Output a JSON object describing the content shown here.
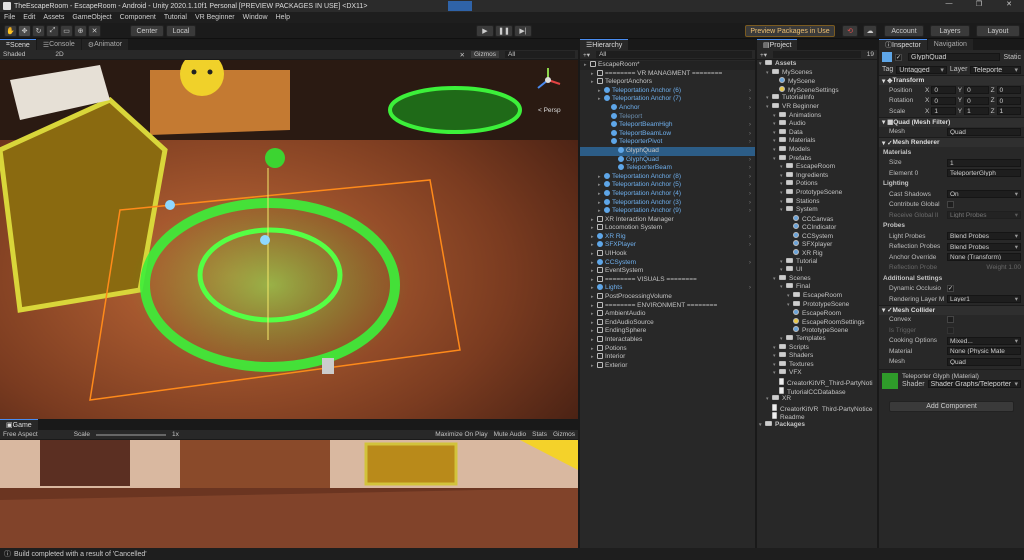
{
  "window": {
    "title": "TheEscapeRoom - EscapeRoom - Android - Unity 2020.1.10f1 Personal [PREVIEW PACKAGES IN USE] <DX11>",
    "controls": [
      "—",
      "❐",
      "✕"
    ]
  },
  "menu": [
    "File",
    "Edit",
    "Assets",
    "GameObject",
    "Component",
    "Tutorial",
    "VR Beginner",
    "Window",
    "Help"
  ],
  "toolbar": {
    "pivot": "Center",
    "space": "Local",
    "preview_packages": "Preview Packages in Use",
    "account": "Account",
    "layers": "Layers",
    "layout": "Layout"
  },
  "scene": {
    "tabs": [
      "Scene",
      "Console",
      "Animator"
    ],
    "shading": "Shaded",
    "mode2d": "2D",
    "gizmos": "Gizmos",
    "search": "All",
    "persp": "< Persp"
  },
  "game": {
    "tab": "Game",
    "aspect": "Free Aspect",
    "scale_label": "Scale",
    "scale_value": "1x",
    "maximize": "Maximize On Play",
    "mute": "Mute Audio",
    "stats": "Stats",
    "gizmos": "Gizmos"
  },
  "hierarchy": {
    "tab": "Hierarchy",
    "search": "All",
    "items": [
      {
        "t": "EscapeRoom*",
        "d": 0,
        "k": "scene"
      },
      {
        "t": "======== VR MANAGMENT ========",
        "d": 1
      },
      {
        "t": "TeleportAnchors",
        "d": 1
      },
      {
        "t": "Teleportation Anchor (6)",
        "d": 2,
        "k": "p"
      },
      {
        "t": "Teleportation Anchor (7)",
        "d": 2,
        "k": "p"
      },
      {
        "t": "Anchor",
        "d": 3,
        "k": "p"
      },
      {
        "t": "Teleport",
        "d": 3,
        "k": "d"
      },
      {
        "t": "TeleportBeamHigh",
        "d": 3,
        "k": "p"
      },
      {
        "t": "TeleportBeamLow",
        "d": 3,
        "k": "p"
      },
      {
        "t": "TeleporterPivot",
        "d": 3,
        "k": "p"
      },
      {
        "t": "GlyphQuad",
        "d": 4,
        "k": "sel"
      },
      {
        "t": "GlyphQuad",
        "d": 4,
        "k": "p"
      },
      {
        "t": "TeleporterBeam",
        "d": 4,
        "k": "p"
      },
      {
        "t": "Teleportation Anchor (8)",
        "d": 2,
        "k": "p"
      },
      {
        "t": "Teleportation Anchor (5)",
        "d": 2,
        "k": "p"
      },
      {
        "t": "Teleportation Anchor (4)",
        "d": 2,
        "k": "p"
      },
      {
        "t": "Teleportation Anchor (3)",
        "d": 2,
        "k": "p"
      },
      {
        "t": "Teleportation Anchor (9)",
        "d": 2,
        "k": "p"
      },
      {
        "t": "XR Interaction Manager",
        "d": 1
      },
      {
        "t": "Locomotion System",
        "d": 1
      },
      {
        "t": "XR Rig",
        "d": 1,
        "k": "p"
      },
      {
        "t": "SFXPlayer",
        "d": 1,
        "k": "p"
      },
      {
        "t": "UIHook",
        "d": 1
      },
      {
        "t": "CCSystem",
        "d": 1,
        "k": "p"
      },
      {
        "t": "EventSystem",
        "d": 1
      },
      {
        "t": "======== VISUALS ========",
        "d": 1
      },
      {
        "t": "Lights",
        "d": 1,
        "k": "p"
      },
      {
        "t": "PostProcessingVolume",
        "d": 1
      },
      {
        "t": "======== ENVIRONMENT ========",
        "d": 1
      },
      {
        "t": "AmbientAudio",
        "d": 1
      },
      {
        "t": "EndAudioSource",
        "d": 1
      },
      {
        "t": "EndingSphere",
        "d": 1
      },
      {
        "t": "Interactables",
        "d": 1
      },
      {
        "t": "Potions",
        "d": 1
      },
      {
        "t": "Interior",
        "d": 1
      },
      {
        "t": "Exterior",
        "d": 1
      }
    ]
  },
  "project": {
    "tab": "Project",
    "count": "19",
    "items": [
      {
        "t": "Assets",
        "d": 0,
        "k": "b"
      },
      {
        "t": "MyScenes",
        "d": 1
      },
      {
        "t": "MyScene",
        "d": 2,
        "k": "s"
      },
      {
        "t": "MySceneSettings",
        "d": 2,
        "k": "y"
      },
      {
        "t": "TutorialInfo",
        "d": 1
      },
      {
        "t": "VR Beginner",
        "d": 1
      },
      {
        "t": "Animations",
        "d": 2
      },
      {
        "t": "Audio",
        "d": 2
      },
      {
        "t": "Data",
        "d": 2
      },
      {
        "t": "Materials",
        "d": 2
      },
      {
        "t": "Models",
        "d": 2
      },
      {
        "t": "Prefabs",
        "d": 2
      },
      {
        "t": "EscapeRoom",
        "d": 3
      },
      {
        "t": "Ingredients",
        "d": 3
      },
      {
        "t": "Potions",
        "d": 3
      },
      {
        "t": "PrototypeScene",
        "d": 3
      },
      {
        "t": "Stations",
        "d": 3
      },
      {
        "t": "System",
        "d": 3
      },
      {
        "t": "CCCanvas",
        "d": 4,
        "k": "s"
      },
      {
        "t": "CCIndicator",
        "d": 4,
        "k": "s"
      },
      {
        "t": "CCSystem",
        "d": 4,
        "k": "s"
      },
      {
        "t": "SFXplayer",
        "d": 4,
        "k": "s"
      },
      {
        "t": "XR Rig",
        "d": 4,
        "k": "s"
      },
      {
        "t": "Tutorial",
        "d": 3
      },
      {
        "t": "UI",
        "d": 3
      },
      {
        "t": "Scenes",
        "d": 2
      },
      {
        "t": "Final",
        "d": 3
      },
      {
        "t": "EscapeRoom",
        "d": 4
      },
      {
        "t": "PrototypeScene",
        "d": 4
      },
      {
        "t": "EscapeRoom",
        "d": 4,
        "k": "s"
      },
      {
        "t": "EscapeRoomSettings",
        "d": 4,
        "k": "y"
      },
      {
        "t": "PrototypeScene",
        "d": 4,
        "k": "s"
      },
      {
        "t": "Templates",
        "d": 3
      },
      {
        "t": "Scripts",
        "d": 2
      },
      {
        "t": "Shaders",
        "d": 2
      },
      {
        "t": "Textures",
        "d": 2
      },
      {
        "t": "VFX",
        "d": 2
      },
      {
        "t": "CreatorKitVR_Third-PartyNoti",
        "d": 2,
        "k": "doc"
      },
      {
        "t": "TutorialCCDatabase",
        "d": 2,
        "k": "doc"
      },
      {
        "t": "XR",
        "d": 1
      },
      {
        "t": "CreatorKitVR_Third-PartyNotice",
        "d": 1,
        "k": "doc"
      },
      {
        "t": "Readme",
        "d": 1,
        "k": "doc"
      },
      {
        "t": "Packages",
        "d": 0,
        "k": "b"
      }
    ]
  },
  "inspector": {
    "tabs": [
      "Inspector",
      "Navigation"
    ],
    "name": "GlyphQuad",
    "static": "Static",
    "tag_label": "Tag",
    "tag": "Untagged",
    "layer_label": "Layer",
    "layer": "Teleporte",
    "transform": {
      "title": "Transform",
      "rows": [
        {
          "l": "Position",
          "x": "0",
          "y": "0",
          "z": "0"
        },
        {
          "l": "Rotation",
          "x": "0",
          "y": "0",
          "z": "0"
        },
        {
          "l": "Scale",
          "x": "1",
          "y": "1",
          "z": "1"
        }
      ]
    },
    "meshfilter": {
      "title": "Quad (Mesh Filter)",
      "mesh_label": "Mesh",
      "mesh": "Quad"
    },
    "renderer": {
      "title": "Mesh Renderer",
      "materials": "Materials",
      "size_label": "Size",
      "size": "1",
      "elem_label": "Element 0",
      "elem": "TeleporterGlyph",
      "lighting": "Lighting",
      "cast_label": "Cast Shadows",
      "cast": "On",
      "contrib_label": "Contribute Global",
      "receive_label": "Receive Global Il",
      "receive": "Light Probes",
      "probes": "Probes",
      "lp_label": "Light Probes",
      "lp": "Blend Probes",
      "rp_label": "Reflection Probes",
      "rp": "Blend Probes",
      "ao_label": "Anchor Override",
      "ao": "None (Transform)",
      "refl_hint": "Reflection Probe",
      "weight_hint": "Weight 1.00",
      "add": "Additional Settings",
      "dyn_label": "Dynamic Occlusio",
      "rl_label": "Rendering Layer M",
      "rl": "Layer1"
    },
    "collider": {
      "title": "Mesh Collider",
      "convex_label": "Convex",
      "trigger_label": "Is Trigger",
      "cook_label": "Cooking Options",
      "cook": "Mixed...",
      "mat_label": "Material",
      "mat": "None (Physic Mate",
      "mesh_label": "Mesh",
      "mesh": "Quad"
    },
    "material": {
      "name": "Teleporter Glyph (Material)",
      "shader_label": "Shader",
      "shader": "Shader Graphs/Teleporter"
    },
    "add_component": "Add Component"
  },
  "status": {
    "text": "Build completed with a result of 'Cancelled'"
  }
}
